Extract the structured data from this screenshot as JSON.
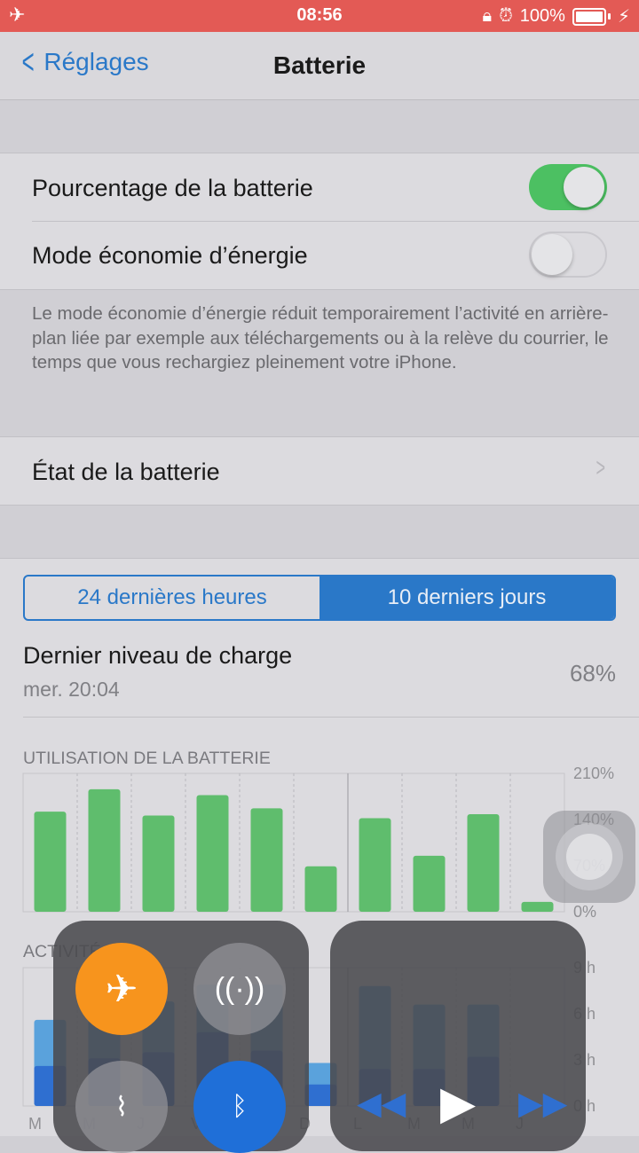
{
  "status": {
    "time": "08:56",
    "battery": "100%",
    "left_icon": "airplane-icon",
    "right_icons": [
      "orientation-lock-icon",
      "alarm-icon",
      "charging-bolt-icon"
    ]
  },
  "nav": {
    "back_label": "Réglages",
    "title": "Batterie"
  },
  "settings": {
    "percentage_label": "Pourcentage de la batterie",
    "percentage_on": true,
    "low_power_label": "Mode économie d’énergie",
    "low_power_on": false,
    "low_power_footer": "Le mode économie d’énergie réduit temporairement l’activité en arrière-plan liée par exemple aux téléchargements ou à la relève du courrier, le temps que vous rechargiez pleinement votre iPhone.",
    "health_label": "État de la batterie"
  },
  "segment": {
    "option1": "24 dernières heures",
    "option2": "10 derniers jours",
    "selected": 2
  },
  "last_charge": {
    "label": "Dernier niveau de charge",
    "time": "mer. 20:04",
    "value": "68%"
  },
  "chart_data": [
    {
      "type": "bar",
      "title": "UTILISATION DE LA BATTERIE",
      "y_tick_labels": [
        "210%",
        "140%",
        "70%",
        "0%"
      ],
      "ylim": [
        0,
        210
      ],
      "categories": [
        "M",
        "M",
        "J",
        "V",
        "S",
        "D",
        "L",
        "M",
        "M",
        "J"
      ],
      "values": [
        152,
        186,
        146,
        177,
        157,
        69,
        142,
        85,
        148,
        15
      ],
      "color": "#5fbd6d"
    },
    {
      "type": "bar",
      "title": "ACTIVITÉ",
      "y_tick_labels": [
        "9 h",
        "6 h",
        "3 h",
        "0 h"
      ],
      "ylim": [
        0,
        9
      ],
      "categories": [
        "M",
        "M",
        "J",
        "V",
        "S",
        "D",
        "L",
        "M",
        "M",
        "J"
      ],
      "series": [
        {
          "name": "",
          "color": "#2f6fd0",
          "values": [
            2.6,
            3.1,
            3.5,
            4.8,
            3.6,
            1.4,
            2.4,
            2.4,
            3.2,
            0
          ]
        },
        {
          "name": "",
          "color": "#5aa2dc",
          "values": [
            5.6,
            5.8,
            6.8,
            7.9,
            7.9,
            2.8,
            7.8,
            6.6,
            6.6,
            0
          ]
        }
      ]
    }
  ],
  "overlay": {
    "left_buttons": [
      "airplane-mode-icon",
      "cellular-icon",
      "wifi-off-icon",
      "bluetooth-off-icon"
    ],
    "right_buttons": [
      "rewind-icon",
      "play-icon",
      "fast-forward-icon"
    ],
    "airplane_color": "#f7941d"
  }
}
